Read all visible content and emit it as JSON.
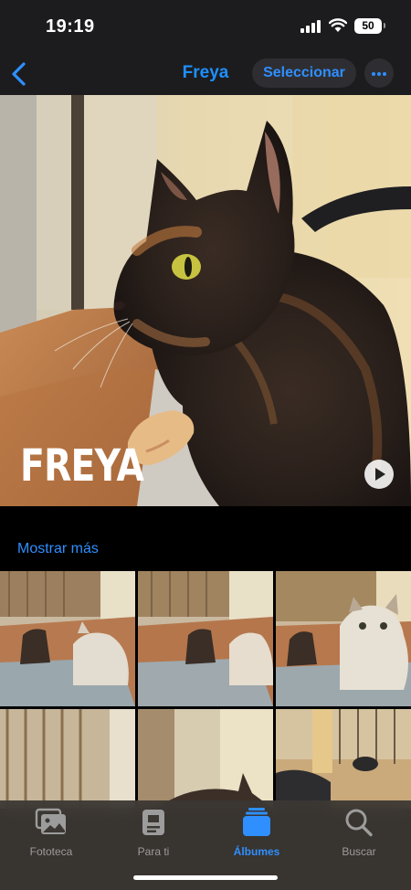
{
  "status": {
    "time": "19:19",
    "battery": "50"
  },
  "nav": {
    "title": "Freya",
    "select_label": "Seleccionar",
    "back_icon": "chevron-left-icon",
    "more_icon": "ellipsis-icon"
  },
  "hero": {
    "title": "FREYA"
  },
  "show_more": "Mostrar más",
  "grid": {
    "count_visible": 6
  },
  "tabs": [
    {
      "label": "Fototeca",
      "icon": "photo-library-icon",
      "active": false
    },
    {
      "label": "Para ti",
      "icon": "for-you-icon",
      "active": false
    },
    {
      "label": "Álbumes",
      "icon": "albums-icon",
      "active": true
    },
    {
      "label": "Buscar",
      "icon": "search-icon",
      "active": false
    }
  ],
  "colors": {
    "accent": "#2f8fff",
    "bar": "#1c1c1e",
    "tabbar": "#3c3834"
  }
}
